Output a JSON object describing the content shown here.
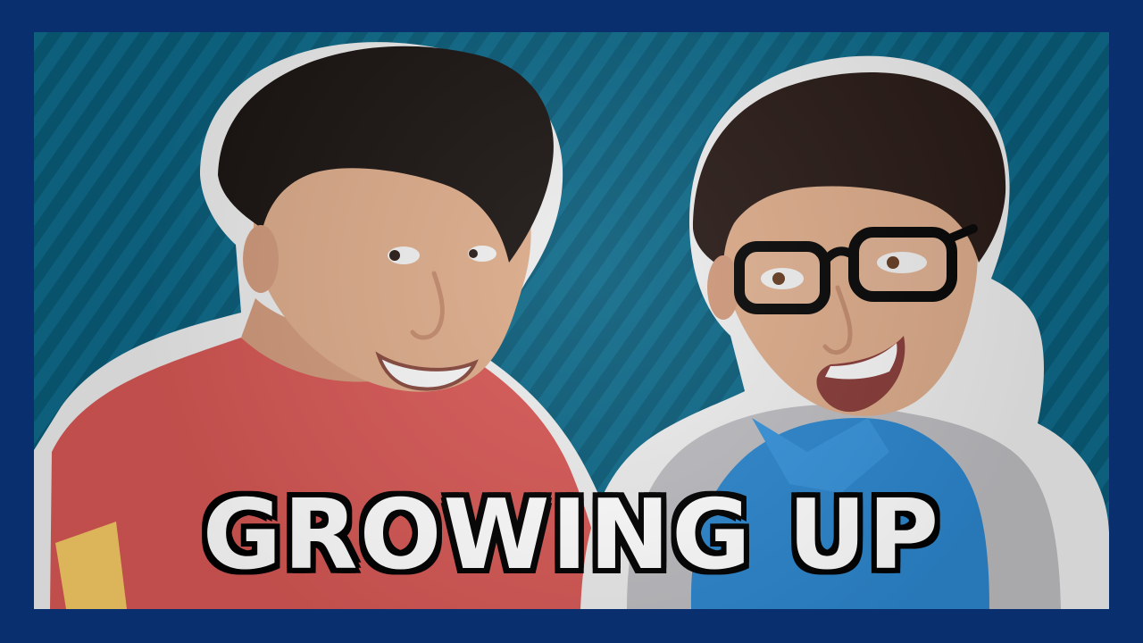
{
  "thumbnail": {
    "title": "GROWING UP"
  },
  "palette": {
    "border": "#0a2f6e",
    "stripes_light": "#0f6f8f",
    "stripes_dark": "#0b5f7d",
    "left_shirt": "#de5b58",
    "right_shirt": "#2e8cd6",
    "hoodie": "#c4c4c8",
    "skin": "#e4b18f",
    "hair": "#1c1513"
  }
}
